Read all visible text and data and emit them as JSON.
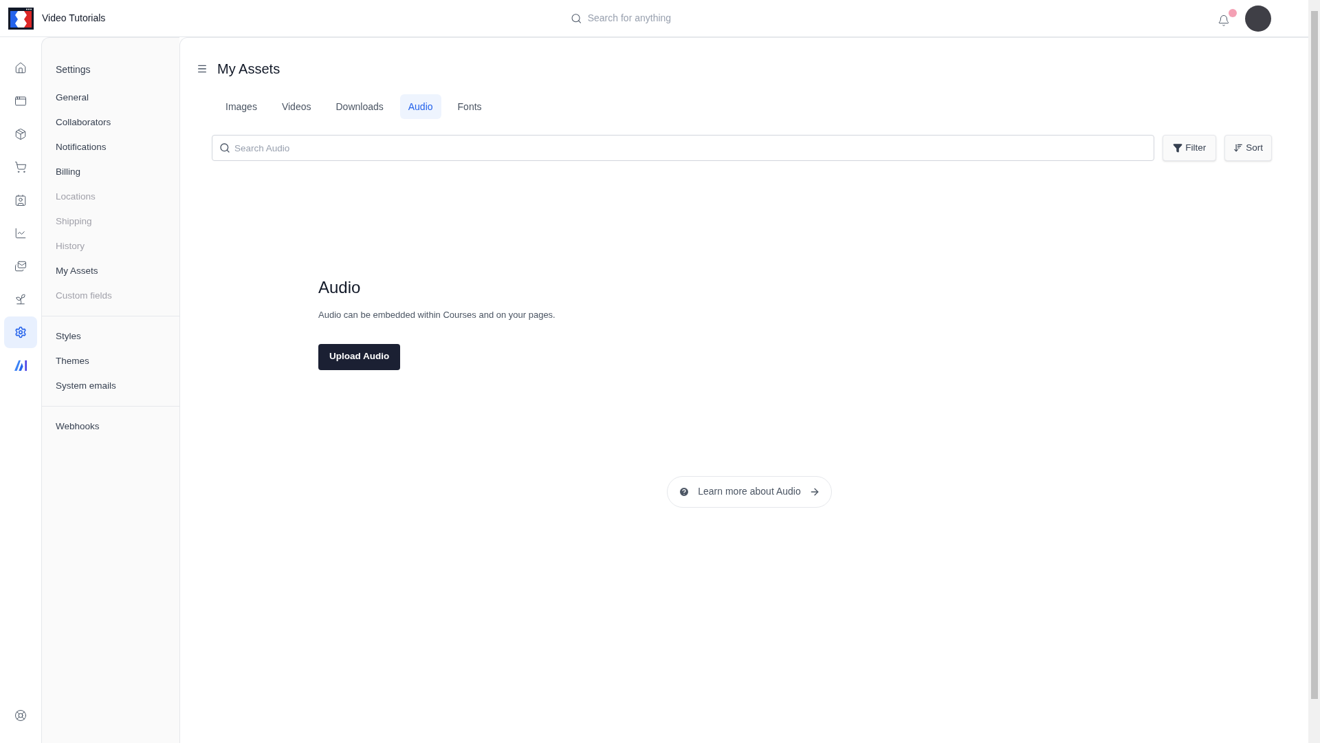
{
  "app": {
    "title": "Video Tutorials"
  },
  "top_search": {
    "placeholder": "Search for anything"
  },
  "notifications": {
    "unread": true
  },
  "rail": [
    {
      "kind": "home",
      "selected": false
    },
    {
      "kind": "window",
      "selected": false
    },
    {
      "kind": "package",
      "selected": false
    },
    {
      "kind": "cart",
      "selected": false
    },
    {
      "kind": "contact",
      "selected": false
    },
    {
      "kind": "chart",
      "selected": false
    },
    {
      "kind": "mail",
      "selected": false
    },
    {
      "kind": "sprout",
      "selected": false
    },
    {
      "kind": "settings",
      "selected": true
    },
    {
      "kind": "ai",
      "selected": false
    }
  ],
  "settings_nav": {
    "title": "Settings",
    "groups": [
      [
        {
          "label": "General",
          "disabled": false
        },
        {
          "label": "Collaborators",
          "disabled": false
        },
        {
          "label": "Notifications",
          "disabled": false
        },
        {
          "label": "Billing",
          "disabled": false
        },
        {
          "label": "Locations",
          "disabled": true
        },
        {
          "label": "Shipping",
          "disabled": true
        },
        {
          "label": "History",
          "disabled": true
        },
        {
          "label": "My Assets",
          "disabled": false
        },
        {
          "label": "Custom fields",
          "disabled": true
        }
      ],
      [
        {
          "label": "Styles",
          "disabled": false
        },
        {
          "label": "Themes",
          "disabled": false
        },
        {
          "label": "System emails",
          "disabled": false
        }
      ],
      [
        {
          "label": "Webhooks",
          "disabled": false
        }
      ]
    ]
  },
  "page": {
    "title": "My Assets",
    "tabs": [
      {
        "label": "Images",
        "selected": false
      },
      {
        "label": "Videos",
        "selected": false
      },
      {
        "label": "Downloads",
        "selected": false
      },
      {
        "label": "Audio",
        "selected": true
      },
      {
        "label": "Fonts",
        "selected": false
      }
    ],
    "search": {
      "placeholder": "Search Audio"
    },
    "filter_button": "Filter",
    "sort_button": "Sort",
    "empty_state": {
      "heading": "Audio",
      "description": "Audio can be embedded within Courses and on your pages.",
      "button": "Upload Audio"
    },
    "learn_more": "Learn more about Audio"
  }
}
